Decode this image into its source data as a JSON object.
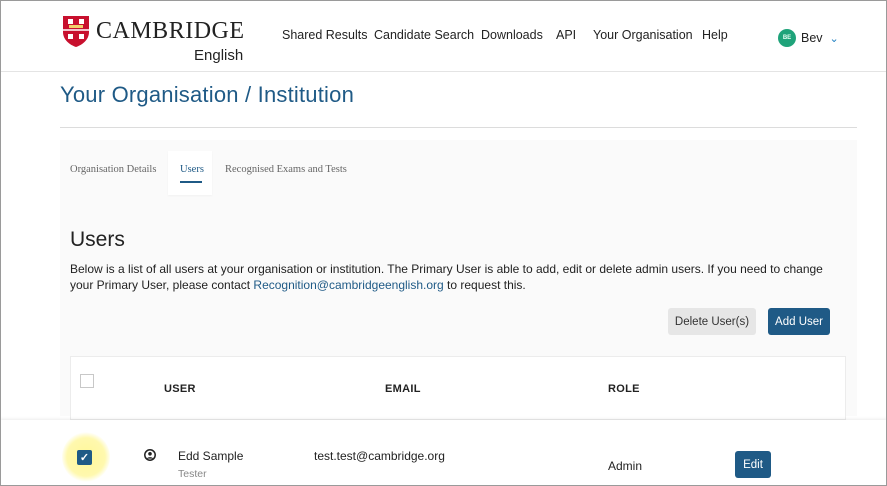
{
  "brand": {
    "name": "CAMBRIDGE",
    "sub": "English",
    "color": "#c8102e"
  },
  "nav": {
    "items": [
      "Shared Results",
      "Candidate Search",
      "Downloads",
      "API",
      "Your Organisation",
      "Help"
    ]
  },
  "user_menu": {
    "initials": "BE",
    "name": "Bev",
    "icon": "chevron-down-icon"
  },
  "page": {
    "title": "Your Organisation / Institution"
  },
  "tabs": [
    {
      "label": "Organisation Details",
      "active": false
    },
    {
      "label": "Users",
      "active": true
    },
    {
      "label": "Recognised Exams and Tests",
      "active": false
    }
  ],
  "users_section": {
    "heading": "Users",
    "desc_before": "Below is a list of all users at your organisation or institution. The Primary User is able to add, edit or delete admin users. If you need to change your Primary User, please contact ",
    "contact_email": "Recognition@cambridgeenglish.org",
    "desc_after": " to request this.",
    "delete_label": "Delete User(s)",
    "add_label": "Add User"
  },
  "table": {
    "headers": [
      "USER",
      "EMAIL",
      "ROLE"
    ],
    "rows": [
      {
        "name": "Edd Sample",
        "subtitle": "Tester",
        "email": "test.test@cambridge.org",
        "role": "Admin",
        "action": "Edit",
        "checked": true
      }
    ]
  },
  "colors": {
    "primary": "#1f5a86",
    "avatar": "#1fa37a",
    "highlight": "#fff68c"
  }
}
